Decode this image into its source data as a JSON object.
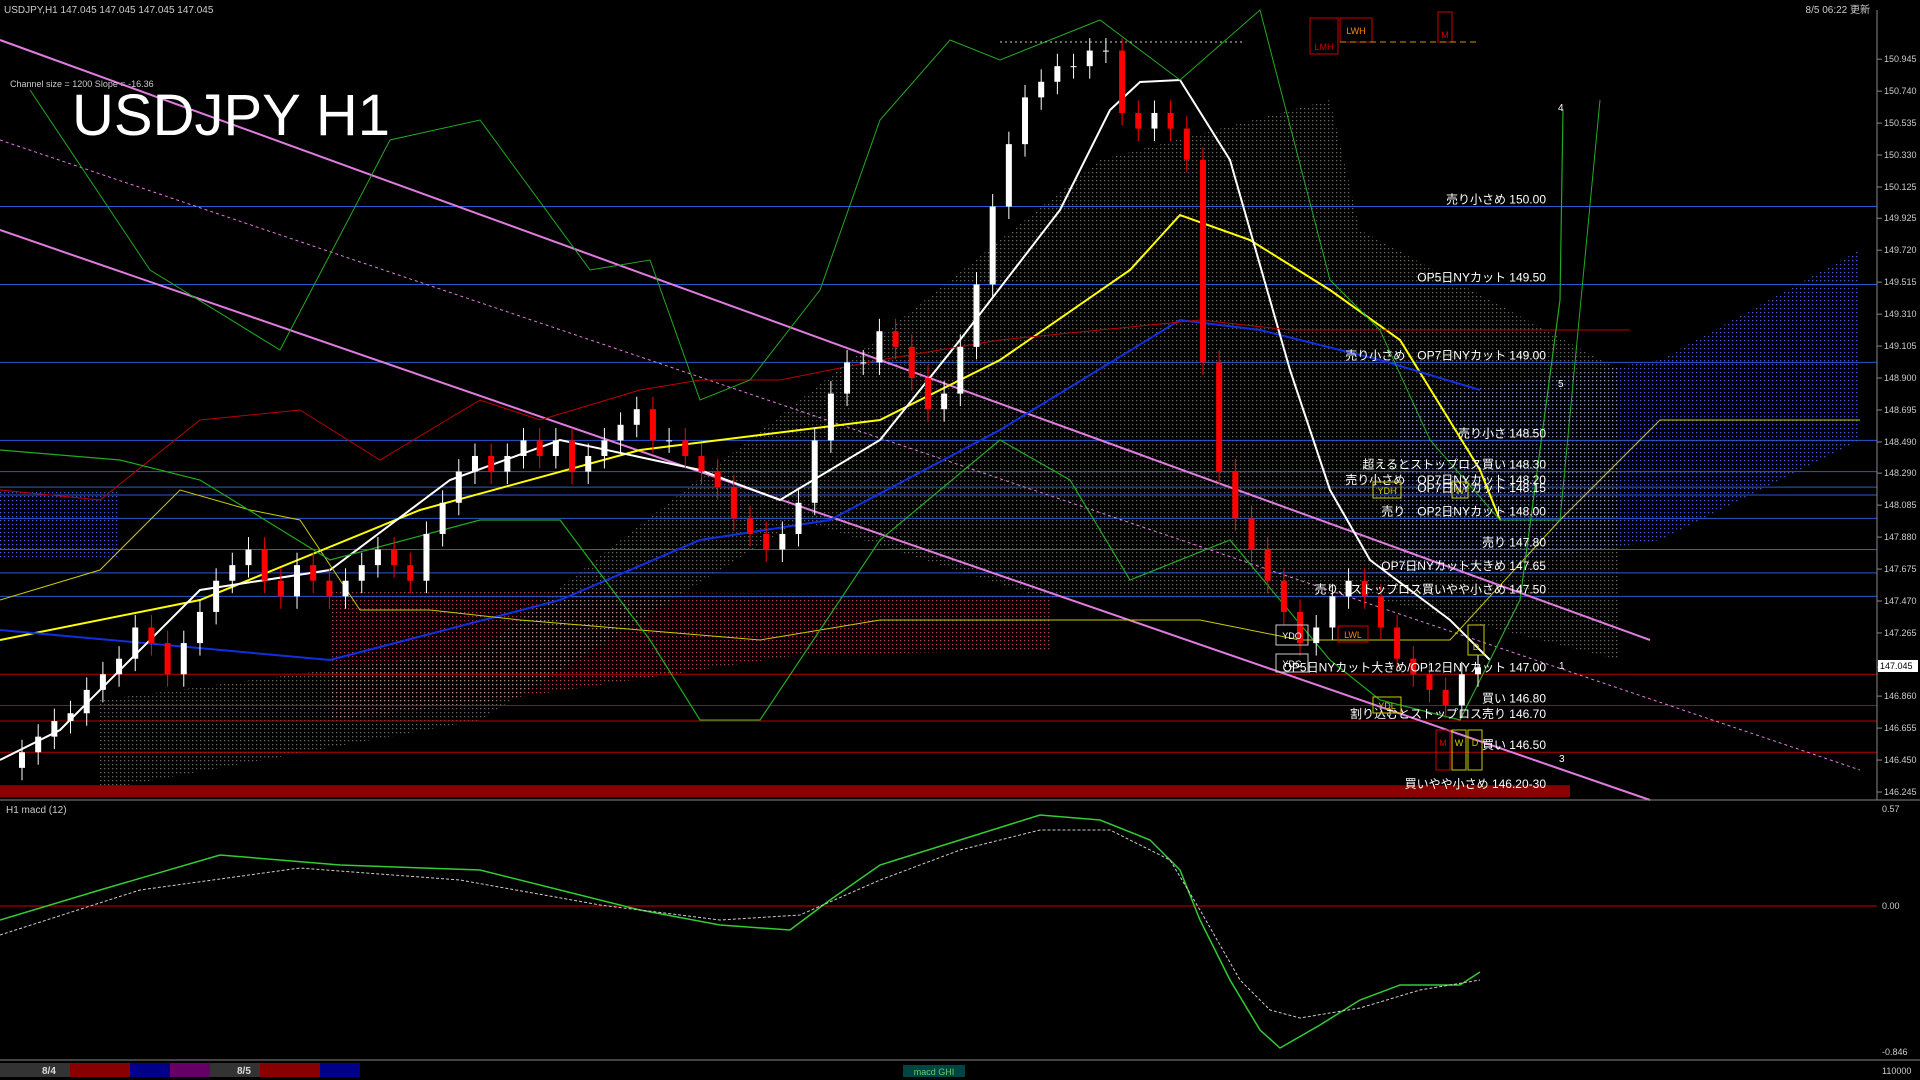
{
  "header": {
    "symbol_line": "USDJPY,H1  147.045 147.045 147.045 147.045",
    "datetime": "8/5 06:22 更新",
    "channel_info": "Channel size = 1200 Slope = -16.36",
    "big_title": "USDJPY H1"
  },
  "macd_panel": {
    "label": "H1  macd (12)",
    "axis_ticks": [
      "0.57",
      "0.00",
      "-0.846"
    ]
  },
  "bottom_bar": {
    "dates": [
      "8/4",
      "8/5"
    ],
    "bottom_axis_value": "110000",
    "tab_label": "macd GHI"
  },
  "chart_data": {
    "type": "line",
    "title": "USDJPY H1",
    "ylim": [
      146.245,
      151.1
    ],
    "y_ticks": [
      150.945,
      150.74,
      150.535,
      150.33,
      150.125,
      149.925,
      149.72,
      149.515,
      149.31,
      149.105,
      148.9,
      148.695,
      148.49,
      148.29,
      148.085,
      147.88,
      147.675,
      147.47,
      147.265,
      147.045,
      146.86,
      146.655,
      146.45,
      146.245
    ],
    "y_tick_labels": [
      "150.945",
      "150.740",
      "150.535",
      "150.330",
      "150.125",
      "149.925",
      "149.720",
      "149.515",
      "149.310",
      "149.105",
      "148.900",
      "148.695",
      "148.490",
      "148.290",
      "148.085",
      "147.880",
      "147.675",
      "147.470",
      "147.265",
      "147.045",
      "146.860",
      "146.655",
      "146.450",
      "146.245"
    ],
    "current_price": 147.045,
    "current_price_label": "147.045",
    "levels": [
      {
        "label": "売り小さめ 150.00",
        "value": 150.0
      },
      {
        "label": "OP5日NYカット 149.50",
        "value": 149.5
      },
      {
        "label": "売り小さめ　OP7日NYカット 149.00",
        "value": 149.0
      },
      {
        "label": "売り小さ 148.50",
        "value": 148.5
      },
      {
        "label": "超えるとストップロス買い 148.30",
        "value": 148.3
      },
      {
        "label": "売り小さめ　OP7日NYカット 148.20",
        "value": 148.2
      },
      {
        "label": "OP7日NYカット 148.15",
        "value": 148.15
      },
      {
        "label": "売り　OP2日NYカット 148.00",
        "value": 148.0
      },
      {
        "label": "売り 147.80",
        "value": 147.8
      },
      {
        "label": "OP7日NYカット大きめ 147.65",
        "value": 147.65
      },
      {
        "label": "売り、ストップロス買いやや小さめ 147.50",
        "value": 147.5
      },
      {
        "label": "OP5日NYカット大きめ/OP12日NYカット 147.00",
        "value": 147.0
      },
      {
        "label": "買い 146.80",
        "value": 146.8
      },
      {
        "label": "割り込むとストップロス売り 146.70",
        "value": 146.7
      },
      {
        "label": "買い 146.50",
        "value": 146.5
      },
      {
        "label": "買いやや小さめ 146.20-30",
        "value": 146.25
      }
    ],
    "markers": [
      "LWH",
      "LMH",
      "M",
      "YDO",
      "YDC",
      "YDH",
      "YDL",
      "LWL",
      "W",
      "D",
      "M",
      "W",
      "D"
    ],
    "wave_labels": [
      "1",
      "3",
      "4",
      "5"
    ],
    "series": [
      {
        "type": "candles",
        "close": [
          146.5,
          146.6,
          146.7,
          146.75,
          146.9,
          147.0,
          147.1,
          147.3,
          147.2,
          147.0,
          147.2,
          147.4,
          147.6,
          147.7,
          147.8,
          147.6,
          147.5,
          147.7,
          147.6,
          147.5,
          147.6,
          147.7,
          147.8,
          147.7,
          147.6,
          147.9,
          148.1,
          148.3,
          148.4,
          148.3,
          148.4,
          148.5,
          148.4,
          148.5,
          148.3,
          148.4,
          148.5,
          148.6,
          148.7,
          148.5,
          148.5,
          148.4,
          148.3,
          148.2,
          148.0,
          147.9,
          147.8,
          147.9,
          148.1,
          148.5,
          148.8,
          149.0,
          149.0,
          149.2,
          149.1,
          148.9,
          148.7,
          148.8,
          149.1,
          149.5,
          150.0,
          150.4,
          150.7,
          150.8,
          150.9,
          150.9,
          151.0,
          151.0,
          150.6,
          150.5,
          150.6,
          150.5,
          150.3,
          149.0,
          148.3,
          148.0,
          147.8,
          147.6,
          147.4,
          147.2,
          147.3,
          147.5,
          147.6,
          147.5,
          147.3,
          147.1,
          147.0,
          146.9,
          146.8,
          147.0,
          147.045
        ]
      }
    ]
  }
}
